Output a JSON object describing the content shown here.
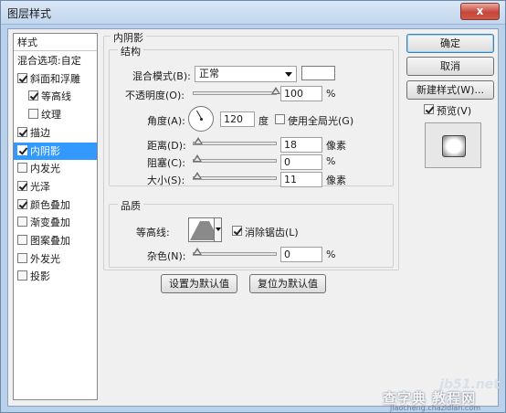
{
  "window": {
    "title": "图层样式",
    "close_glyph": "x"
  },
  "sidebar": {
    "header": "样式",
    "items": [
      {
        "label": "混合选项:自定",
        "checkbox": false,
        "checked": false,
        "sub": false
      },
      {
        "label": "斜面和浮雕",
        "checkbox": true,
        "checked": true,
        "sub": false
      },
      {
        "label": "等高线",
        "checkbox": true,
        "checked": true,
        "sub": true
      },
      {
        "label": "纹理",
        "checkbox": true,
        "checked": false,
        "sub": true
      },
      {
        "label": "描边",
        "checkbox": true,
        "checked": true,
        "sub": false
      },
      {
        "label": "内阴影",
        "checkbox": true,
        "checked": true,
        "sub": false,
        "selected": true
      },
      {
        "label": "内发光",
        "checkbox": true,
        "checked": false,
        "sub": false
      },
      {
        "label": "光泽",
        "checkbox": true,
        "checked": true,
        "sub": false
      },
      {
        "label": "颜色叠加",
        "checkbox": true,
        "checked": true,
        "sub": false
      },
      {
        "label": "渐变叠加",
        "checkbox": true,
        "checked": false,
        "sub": false
      },
      {
        "label": "图案叠加",
        "checkbox": true,
        "checked": false,
        "sub": false
      },
      {
        "label": "外发光",
        "checkbox": true,
        "checked": false,
        "sub": false
      },
      {
        "label": "投影",
        "checkbox": true,
        "checked": false,
        "sub": false
      }
    ]
  },
  "panel": {
    "title": "内阴影",
    "structure": {
      "title": "结构",
      "blend_mode_label": "混合模式(B):",
      "blend_mode_value": "正常",
      "blend_color": "#ffffff",
      "opacity_label": "不透明度(O):",
      "opacity_value": "100",
      "opacity_fraction": 1.0,
      "opacity_unit": "%",
      "angle_label": "角度(A):",
      "angle_value": "120",
      "angle_unit": "度",
      "global_light_label": "使用全局光(G)",
      "global_light_checked": false,
      "distance_label": "距离(D):",
      "distance_value": "18",
      "distance_fraction": 0.06,
      "distance_unit": "像素",
      "choke_label": "阻塞(C):",
      "choke_value": "0",
      "choke_fraction": 0.0,
      "choke_unit": "%",
      "size_label": "大小(S):",
      "size_value": "11",
      "size_fraction": 0.04,
      "size_unit": "像素"
    },
    "quality": {
      "title": "品质",
      "contour_label": "等高线:",
      "antialias_label": "消除锯齿(L)",
      "antialias_checked": true,
      "noise_label": "杂色(N):",
      "noise_value": "0",
      "noise_fraction": 0.0,
      "noise_unit": "%"
    },
    "make_default_label": "设置为默认值",
    "reset_default_label": "复位为默认值"
  },
  "actions": {
    "ok_label": "确定",
    "cancel_label": "取消",
    "new_style_label": "新建样式(W)...",
    "preview_label": "预览(V)",
    "preview_checked": true
  },
  "watermark": {
    "line1": "jb51.net",
    "line2": "查字典 教程网",
    "line3": "jiaocheng.chazidian.com"
  }
}
